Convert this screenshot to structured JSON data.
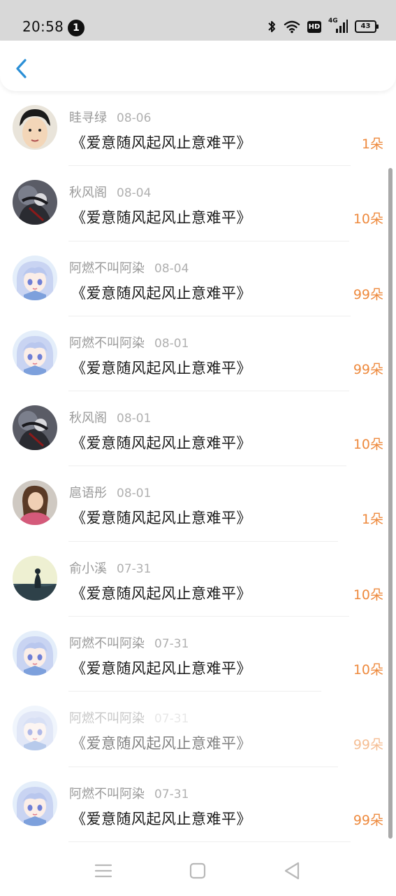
{
  "status_bar": {
    "time": "20:58",
    "notification_count": "1",
    "hd_label": "HD",
    "network_label": "4G",
    "battery_level": "43"
  },
  "rows": [
    {
      "name": "眭寻绿",
      "date": "08-06",
      "title": "《爱意随风起风止意难平》",
      "amount": "1朵",
      "avatar": "boy"
    },
    {
      "name": "秋风阁",
      "date": "08-04",
      "title": "《爱意随风起风止意难平》",
      "amount": "10朵",
      "avatar": "dark"
    },
    {
      "name": "阿燃不叫阿染",
      "date": "08-04",
      "title": "《爱意随风起风止意难平》",
      "amount": "99朵",
      "avatar": "anime"
    },
    {
      "name": "阿燃不叫阿染",
      "date": "08-01",
      "title": "《爱意随风起风止意难平》",
      "amount": "99朵",
      "avatar": "anime"
    },
    {
      "name": "秋风阁",
      "date": "08-01",
      "title": "《爱意随风起风止意难平》",
      "amount": "10朵",
      "avatar": "dark"
    },
    {
      "name": "扈语彤",
      "date": "08-01",
      "title": "《爱意随风起风止意难平》",
      "amount": "1朵",
      "avatar": "woman"
    },
    {
      "name": "俞小溪",
      "date": "07-31",
      "title": "《爱意随风起风止意难平》",
      "amount": "10朵",
      "avatar": "landscape"
    },
    {
      "name": "阿燃不叫阿染",
      "date": "07-31",
      "title": "《爱意随风起风止意难平》",
      "amount": "10朵",
      "avatar": "anime"
    },
    {
      "name": "阿燃不叫阿染",
      "date": "07-31",
      "title": "《爱意随风起风止意难平》",
      "amount": "99朵",
      "avatar": "anime"
    },
    {
      "name": "阿燃不叫阿染",
      "date": "07-31",
      "title": "《爱意随风起风止意难平》",
      "amount": "99朵",
      "avatar": "anime"
    }
  ],
  "colors": {
    "accent": "#2b8fd6",
    "amount": "#ee8a3e",
    "name": "#9a9a9a"
  }
}
